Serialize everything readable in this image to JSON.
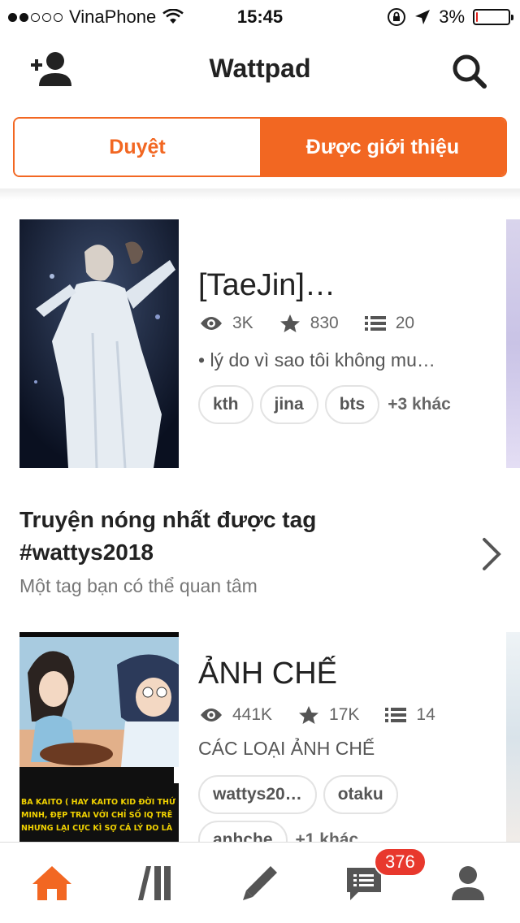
{
  "status_bar": {
    "carrier": "VinaPhone",
    "time": "15:45",
    "battery": "3%",
    "battery_level": 0.03,
    "signal_bars": 2
  },
  "header": {
    "title": "Wattpad",
    "left_icon": "add-friend-icon",
    "right_icon": "search-icon"
  },
  "segments": {
    "tabs": [
      {
        "label": "Duyệt",
        "active": false
      },
      {
        "label": "Được giới thiệu",
        "active": true
      }
    ]
  },
  "stories": [
    {
      "title": "[TaeJin]…",
      "reads": "3K",
      "votes": "830",
      "parts": "20",
      "description": "• lý do vì sao tôi không mu…",
      "tags": [
        "kth",
        "jina",
        "bts"
      ],
      "more_tags": "+3 khác"
    },
    {
      "title": "ẢNH CHẾ",
      "reads": "441K",
      "votes": "17K",
      "parts": "14",
      "description": "CÁC LOẠI ẢNH CHẾ",
      "tags": [
        "wattys20…",
        "otaku",
        "anhche"
      ],
      "more_tags": "+1 khác",
      "cover_caption": "BA KAITO ( HAY KAITO KID ĐỜI THỨ … MINH, ĐẸP TRAI VỚI CHỈ SỐ IQ TRÊ… NHƯNG LẠI CỰC KÌ SỢ CÁ LÝ DO LÀ … "
    }
  ],
  "section": {
    "title": "Truyện nóng nhất được tag #wattys2018",
    "subtitle": "Một tag bạn có thể quan tâm"
  },
  "tab_bar": {
    "items": [
      "home-icon",
      "library-icon",
      "write-icon",
      "messages-icon",
      "profile-icon"
    ],
    "messages_badge": "376",
    "active_color": "#f26722",
    "inactive_color": "#555555"
  },
  "colors": {
    "accent": "#f26722"
  }
}
